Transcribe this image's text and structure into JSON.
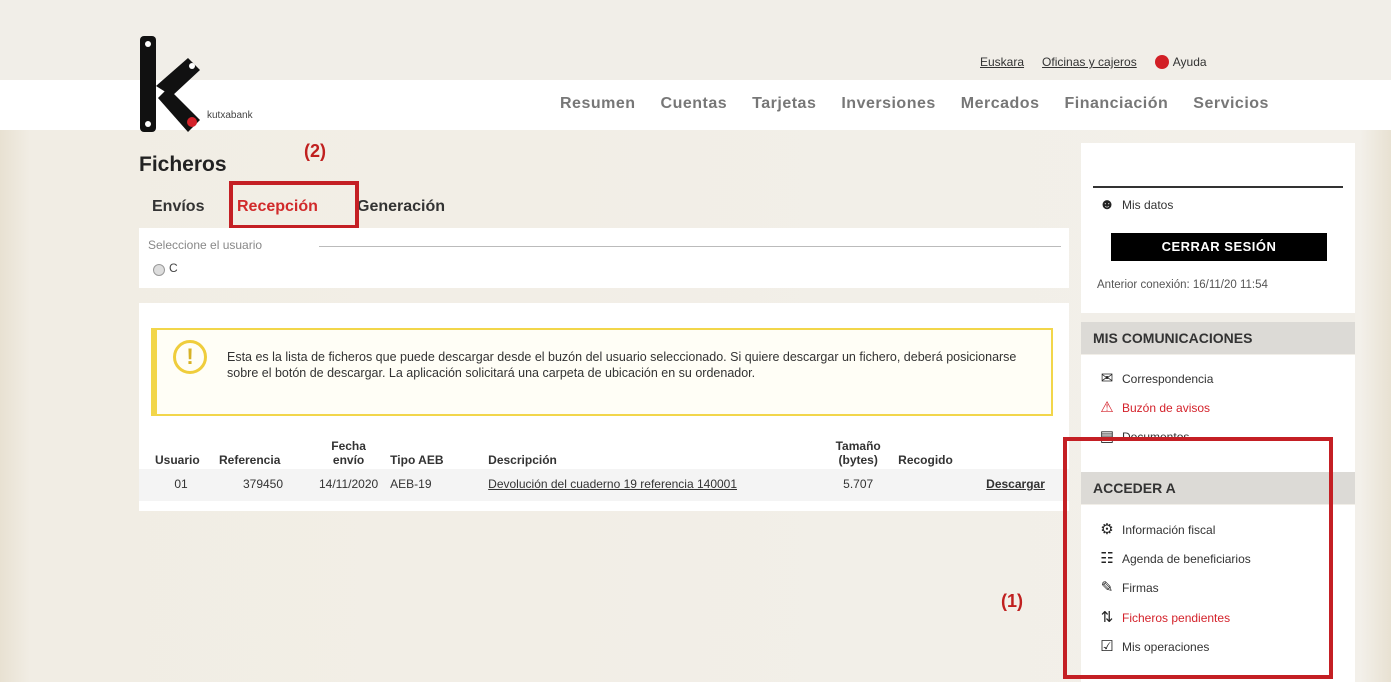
{
  "header": {
    "brand": "kutxabank",
    "links": {
      "language": "Euskara",
      "offices": "Oficinas y cajeros",
      "help": "Ayuda"
    },
    "nav": [
      "Resumen",
      "Cuentas",
      "Tarjetas",
      "Inversiones",
      "Mercados",
      "Financiación",
      "Servicios"
    ]
  },
  "page": {
    "title": "Ficheros",
    "tabs": [
      "Envíos",
      "Recepción",
      "Generación"
    ],
    "active_tab": "Recepción"
  },
  "user_select": {
    "legend": "Seleccione el usuario",
    "option": "C"
  },
  "notice": {
    "text": "Esta es la lista de ficheros que puede descargar desde el buzón del usuario seleccionado. Si quiere descargar un fichero, deberá posicionarse sobre el botón de descargar. La aplicación solicitará una carpeta de ubicación en su ordenador."
  },
  "table": {
    "columns": [
      "Usuario",
      "Referencia",
      "Fecha envío",
      "Tipo AEB",
      "Descripción",
      "Tamaño (bytes)",
      "Recogido"
    ],
    "rows": [
      {
        "usuario": "01",
        "referencia": "379450",
        "fecha": "14/11/2020",
        "tipo": "AEB-19",
        "descripcion": "Devolución del cuaderno 19 referencia 140001",
        "tamano": "5.707",
        "recogido": "",
        "accion": "Descargar"
      }
    ]
  },
  "sidebar": {
    "my_data": "Mis datos",
    "logout": "CERRAR SESIÓN",
    "last_connection": "Anterior conexión: 16/11/20 11:54",
    "comms_title": "MIS COMUNICACIONES",
    "comms": [
      "Correspondencia",
      "Buzón de avisos",
      "Documentos"
    ],
    "access_title": "ACCEDER A",
    "access": [
      "Información fiscal",
      "Agenda de beneficiarios",
      "Firmas",
      "Ficheros pendientes",
      "Mis operaciones"
    ]
  },
  "annotations": {
    "one": "(1)",
    "two": "(2)"
  },
  "colors": {
    "brand_red": "#d4222b",
    "highlight_box": "#c41f24",
    "notice_yellow": "#f2d64a"
  }
}
